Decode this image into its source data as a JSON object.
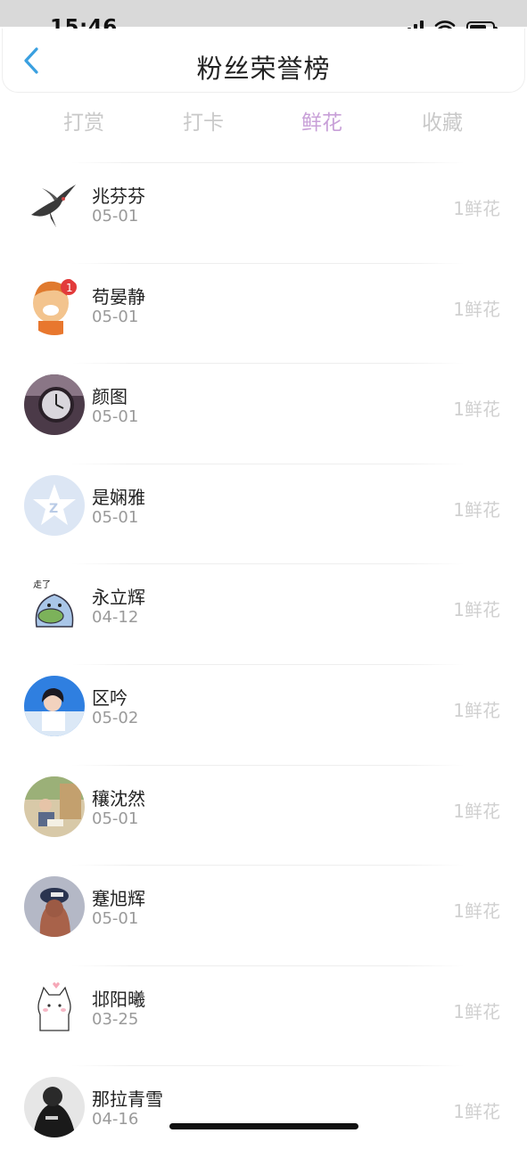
{
  "status_bar": {
    "time": "15:46"
  },
  "header": {
    "title": "粉丝荣誉榜",
    "back_icon": "chevron-left-icon"
  },
  "tabs": [
    {
      "label": "打赏",
      "active": false
    },
    {
      "label": "打卡",
      "active": false
    },
    {
      "label": "鲜花",
      "active": true
    },
    {
      "label": "收藏",
      "active": false
    }
  ],
  "colors": {
    "accent": "#c8a0d8",
    "back_arrow": "#3aa0e0",
    "inactive_tab": "#c9c9c9"
  },
  "fans": [
    {
      "name": "兆芬芬",
      "date": "05-01",
      "count": "1鲜花",
      "avatar": "swallow-bird"
    },
    {
      "name": "苟晏静",
      "date": "05-01",
      "count": "1鲜花",
      "avatar": "cartoon-boy"
    },
    {
      "name": "颜图",
      "date": "05-01",
      "count": "1鲜花",
      "avatar": "clock"
    },
    {
      "name": "是娴雅",
      "date": "05-01",
      "count": "1鲜花",
      "avatar": "default-star"
    },
    {
      "name": "永立辉",
      "date": "04-12",
      "count": "1鲜花",
      "avatar": "green-frog"
    },
    {
      "name": "区吟",
      "date": "05-02",
      "count": "1鲜花",
      "avatar": "girl-blue-sky"
    },
    {
      "name": "穰沈然",
      "date": "05-01",
      "count": "1鲜花",
      "avatar": "child-reading"
    },
    {
      "name": "蹇旭辉",
      "date": "05-01",
      "count": "1鲜花",
      "avatar": "girl-cap"
    },
    {
      "name": "邶阳曦",
      "date": "03-25",
      "count": "1鲜花",
      "avatar": "white-cat"
    },
    {
      "name": "那拉青雪",
      "date": "04-16",
      "count": "1鲜花",
      "avatar": "black-white-photo"
    }
  ]
}
